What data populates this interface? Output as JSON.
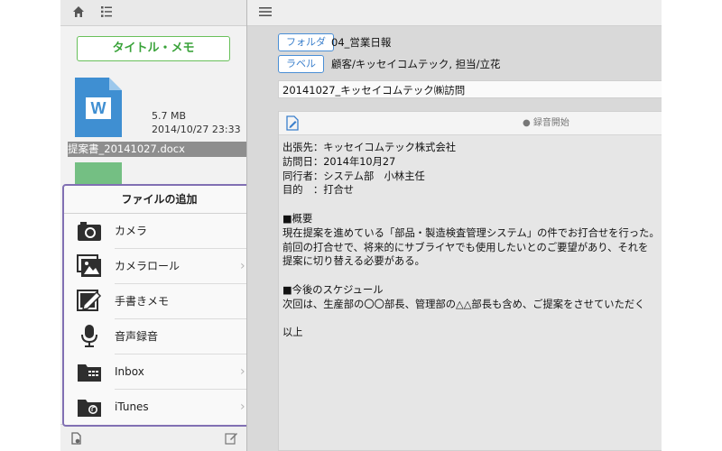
{
  "left_pane": {
    "title_memo_button": "タイトル・メモ",
    "file": {
      "size": "5.7 MB",
      "date": "2014/10/27 23:33",
      "name": "提案書_20141027.docx",
      "icon": "word-document-icon"
    }
  },
  "popover": {
    "title": "ファイルの追加",
    "items": [
      {
        "label": "カメラ",
        "icon": "camera-icon",
        "chevron": ""
      },
      {
        "label": "カメラロール",
        "icon": "photo-library-icon",
        "chevron": "›"
      },
      {
        "label": "手書きメモ",
        "icon": "handwriting-icon",
        "chevron": ""
      },
      {
        "label": "音声録音",
        "icon": "microphone-icon",
        "chevron": ""
      },
      {
        "label": "Inbox",
        "icon": "inbox-folder-icon",
        "chevron": "›"
      },
      {
        "label": "iTunes",
        "icon": "itunes-folder-icon",
        "chevron": "›"
      }
    ]
  },
  "right_pane": {
    "folder_button": "フォルダ",
    "folder_value": "04_営業日報",
    "label_button": "ラベル",
    "label_value": "顧客/キッセイコムテック, 担当/立花",
    "title_value": "20141027_キッセイコムテック㈱訪問",
    "record_label": "● 録音開始",
    "memo": "出張先：キッセイコムテック株式会社\n訪問日：2014年10月27\n同行者：システム部　小林主任\n目的　：打合せ\n\n■概要\n現在提案を進めている「部品・製造検査管理システム」の件でお打合せを行った。\n前回の打合せで、将来的にサブライヤでも使用したいとのご要望があり、それを\n提案に切り替える必要がある。\n\n■今後のスケジュール\n次回は、生産部の〇〇部長、管理部の△△部長も含め、ご提案をさせていただく\n\n以上"
  },
  "colors": {
    "accent_blue": "#3a7fcc",
    "accent_green": "#3aa33a",
    "popover_border": "#8170b3",
    "word_blue": "#3f8fd2"
  }
}
